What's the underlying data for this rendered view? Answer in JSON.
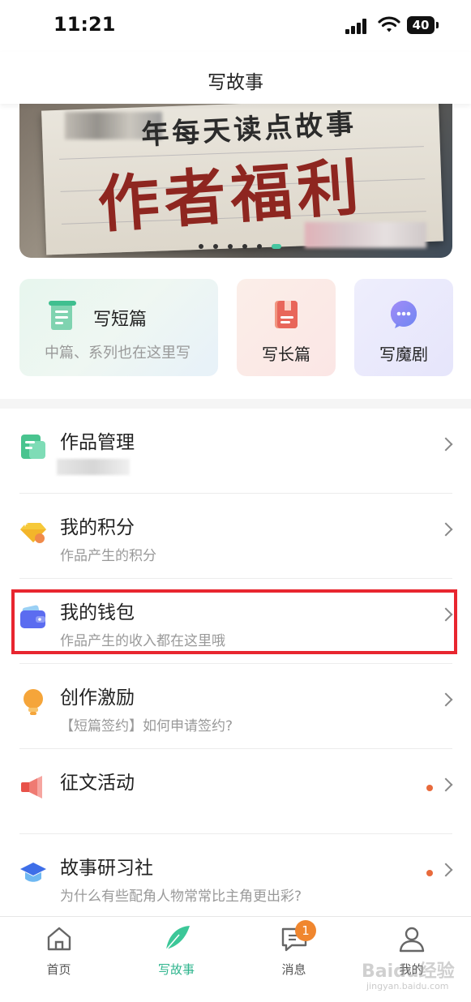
{
  "status_bar": {
    "time": "11:21",
    "battery": "40"
  },
  "navbar": {
    "title": "写故事"
  },
  "banner": {
    "subtitle": "年每天读点故事",
    "title": "作者福利",
    "slide_count": 6,
    "active_slide": 6
  },
  "quick_actions": [
    {
      "title": "写短篇",
      "subtitle": "中篇、系列也在这里写",
      "icon": "short-story-icon"
    },
    {
      "title": "写长篇",
      "icon": "long-story-icon"
    },
    {
      "title": "写魔剧",
      "icon": "chat-drama-icon"
    }
  ],
  "menu": [
    {
      "title": "作品管理",
      "subtitle": "",
      "icon": "works-document-icon",
      "dot": false
    },
    {
      "title": "我的积分",
      "subtitle": "作品产生的积分",
      "icon": "diamond-points-icon",
      "dot": false
    },
    {
      "title": "我的钱包",
      "subtitle": "作品产生的收入都在这里哦",
      "icon": "wallet-icon",
      "dot": false
    },
    {
      "title": "创作激励",
      "subtitle": "【短篇签约】如何申请签约?",
      "icon": "bulb-icon",
      "dot": false
    },
    {
      "title": "征文活动",
      "subtitle": "",
      "icon": "megaphone-icon",
      "dot": true
    },
    {
      "title": "故事研习社",
      "subtitle": "为什么有些配角人物常常比主角更出彩?",
      "icon": "graduation-cap-icon",
      "dot": true
    }
  ],
  "tabbar": {
    "items": [
      {
        "label": "首页",
        "icon": "home-icon"
      },
      {
        "label": "写故事",
        "icon": "feather-icon",
        "active": true
      },
      {
        "label": "消息",
        "icon": "message-icon",
        "badge": "1"
      },
      {
        "label": "我的",
        "icon": "profile-icon"
      }
    ]
  },
  "watermark": {
    "text": "Baidu经验",
    "url_text": "jingyan.baidu.com"
  },
  "colors": {
    "accent": "#2fb58e",
    "highlight": "#e8262f",
    "badge": "#f0862e",
    "dot": "#e86a3c"
  }
}
